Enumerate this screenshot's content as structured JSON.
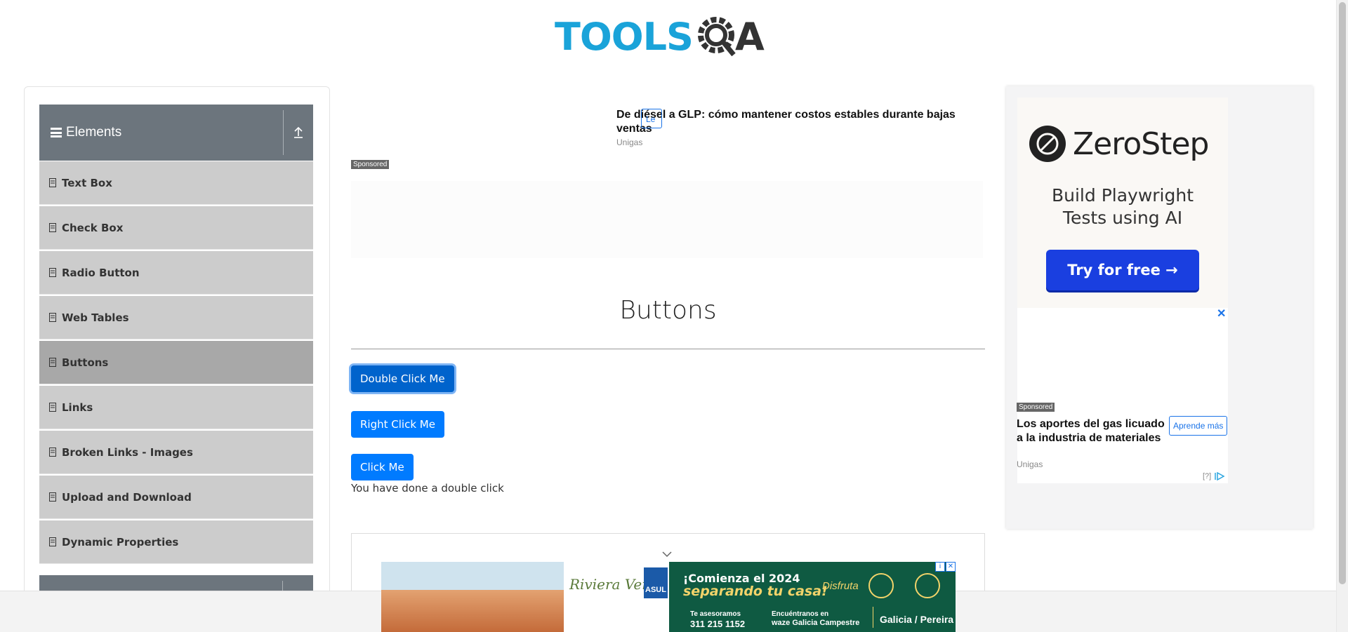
{
  "header": {
    "logo_text": "TOOLS",
    "logo_suffix": "A"
  },
  "sidebar": {
    "group_title": "Elements",
    "items": [
      {
        "label": "Text Box"
      },
      {
        "label": "Check Box"
      },
      {
        "label": "Radio Button"
      },
      {
        "label": "Web Tables"
      },
      {
        "label": "Buttons",
        "active": true
      },
      {
        "label": "Links"
      },
      {
        "label": "Broken Links - Images"
      },
      {
        "label": "Upload and Download"
      },
      {
        "label": "Dynamic Properties"
      }
    ]
  },
  "top_ad": {
    "title": "De diésel a GLP: cómo mantener costos estables durante bajas ventas",
    "source": "Unigas",
    "sponsored": "Sponsored",
    "learn_more": "Le"
  },
  "main": {
    "title": "Buttons",
    "double_click_label": "Double Click Me",
    "right_click_label": "Right Click Me",
    "click_label": "Click Me",
    "result_message": "You have done a double click"
  },
  "right_ad": {
    "brand": "ZeroStep",
    "tagline_line1": "Build Playwright",
    "tagline_line2": "Tests using AI",
    "cta": "Try for free →",
    "close": "✕",
    "sponsored": "Sponsored",
    "native_title": "Los aportes del gas licuado a la industria de materiales",
    "native_source": "Unigas",
    "native_learn": "Aprende más",
    "adchoices": "[?]"
  },
  "banner": {
    "brand": "Riviera Verde",
    "brand_sub": "ASUL",
    "headline": "¡Comienza el 2024",
    "headline_sub": "separando tu casa!",
    "disfruta": "Disfruta",
    "phone_label": "Te asesoramos",
    "phone": "311 215 1152",
    "waze_label": "Encuéntranos en",
    "waze": "waze Galicia Campestre",
    "city": "Galicia / Pereira"
  },
  "colors": {
    "primary": "#007bff",
    "sidebar_header": "#6c757d",
    "menu_item": "#cccccc",
    "menu_active": "#a8a8a8",
    "cta_blue": "#1a3fe0"
  }
}
